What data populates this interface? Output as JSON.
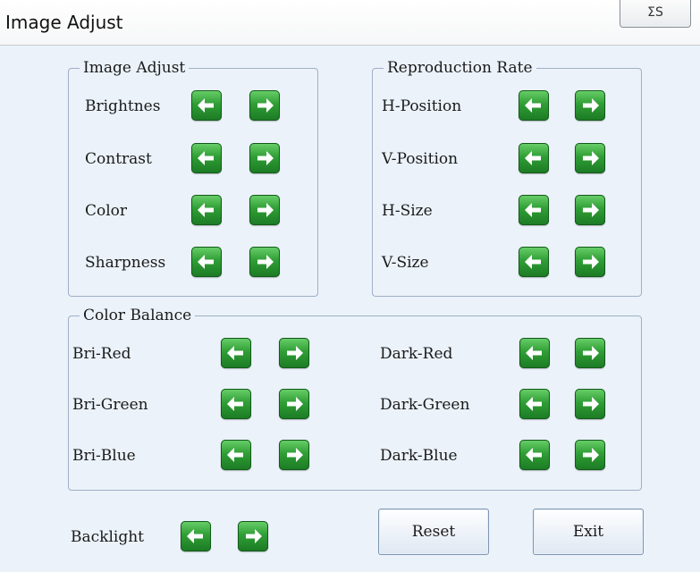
{
  "window": {
    "title": "Image Adjust",
    "close_glyph": "ΣS"
  },
  "image_adjust": {
    "legend": "Image Adjust",
    "rows": [
      {
        "label": "Brightnes"
      },
      {
        "label": "Contrast"
      },
      {
        "label": "Color"
      },
      {
        "label": "Sharpness"
      }
    ]
  },
  "reproduction_rate": {
    "legend": "Reproduction Rate",
    "rows": [
      {
        "label": "H-Position"
      },
      {
        "label": "V-Position"
      },
      {
        "label": "H-Size"
      },
      {
        "label": "V-Size"
      }
    ]
  },
  "color_balance": {
    "legend": "Color Balance",
    "left": [
      {
        "label": "Bri-Red"
      },
      {
        "label": "Bri-Green"
      },
      {
        "label": "Bri-Blue"
      }
    ],
    "right": [
      {
        "label": "Dark-Red"
      },
      {
        "label": "Dark-Green"
      },
      {
        "label": "Dark-Blue"
      }
    ]
  },
  "backlight": {
    "label": "Backlight"
  },
  "buttons": {
    "reset": "Reset",
    "exit": "Exit"
  },
  "icons": {
    "decrease": "left-arrow-icon",
    "increase": "right-arrow-icon"
  },
  "colors": {
    "arrow_green": "#2f9e35",
    "panel_bg": "#ebf2fa",
    "group_border": "#9fb0c4"
  }
}
